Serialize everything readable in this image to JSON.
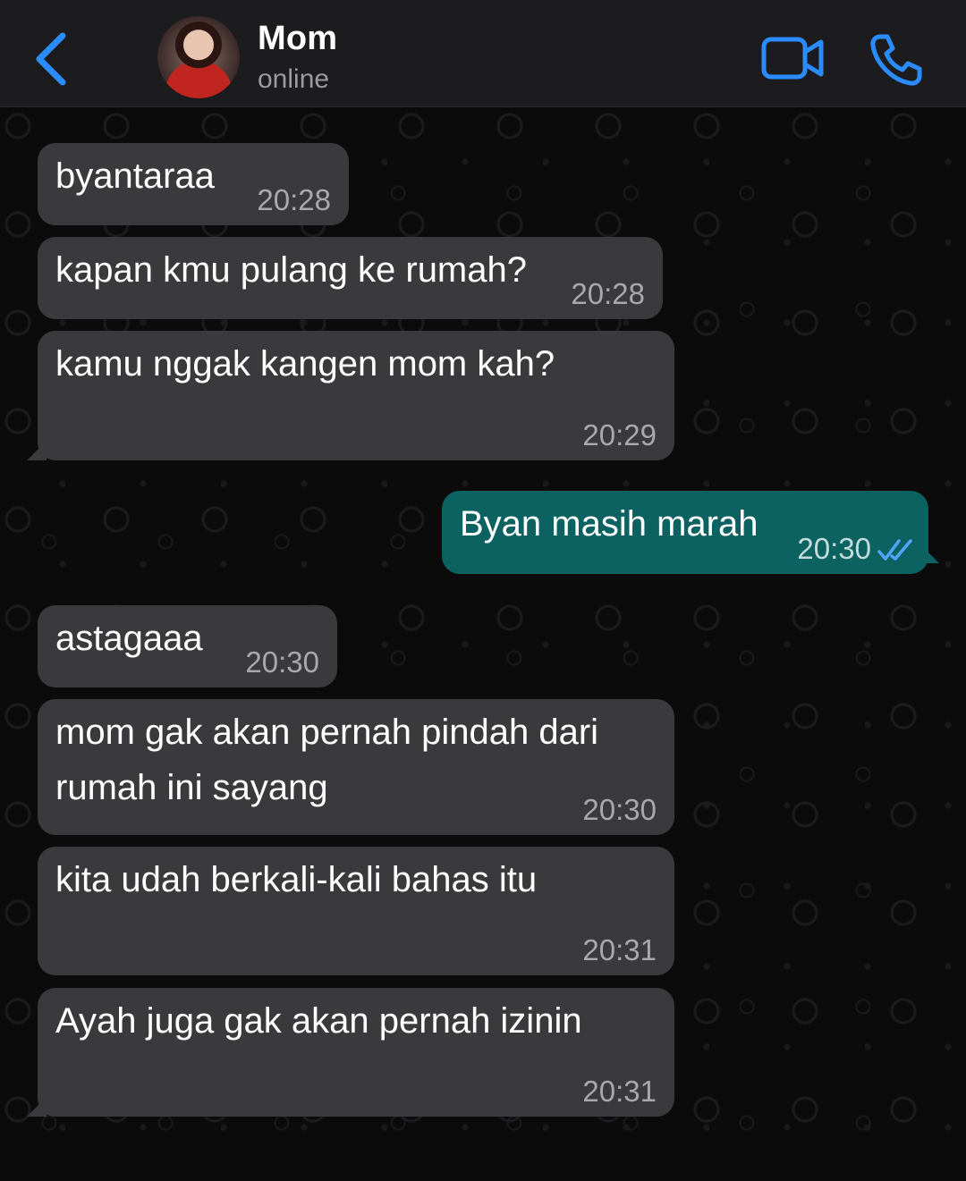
{
  "header": {
    "contact_name": "Mom",
    "status": "online",
    "accent_color": "#2b8cff",
    "icons": [
      "chevron-left-icon",
      "video-camera-icon",
      "phone-icon"
    ]
  },
  "messages": [
    {
      "direction": "in",
      "text": "byantaraa",
      "time": "20:28"
    },
    {
      "direction": "in",
      "text": "kapan kmu pulang ke rumah?",
      "time": "20:28"
    },
    {
      "direction": "in",
      "text": "kamu nggak kangen mom kah?",
      "time": "20:29"
    },
    {
      "direction": "out",
      "text": "Byan masih marah",
      "time": "20:30",
      "status": "read"
    },
    {
      "direction": "in",
      "text": "astagaaa",
      "time": "20:30"
    },
    {
      "direction": "in",
      "text": "mom gak akan pernah pindah dari\nrumah ini sayang",
      "time": "20:30"
    },
    {
      "direction": "in",
      "text": "kita udah berkali-kali bahas itu",
      "time": "20:31"
    },
    {
      "direction": "in",
      "text": "Ayah juga gak akan pernah izinin",
      "time": "20:31"
    }
  ],
  "colors": {
    "incoming_bubble": "#3a3a3c",
    "outgoing_bubble": "#0b6260",
    "read_ticks": "#53a6ff"
  }
}
